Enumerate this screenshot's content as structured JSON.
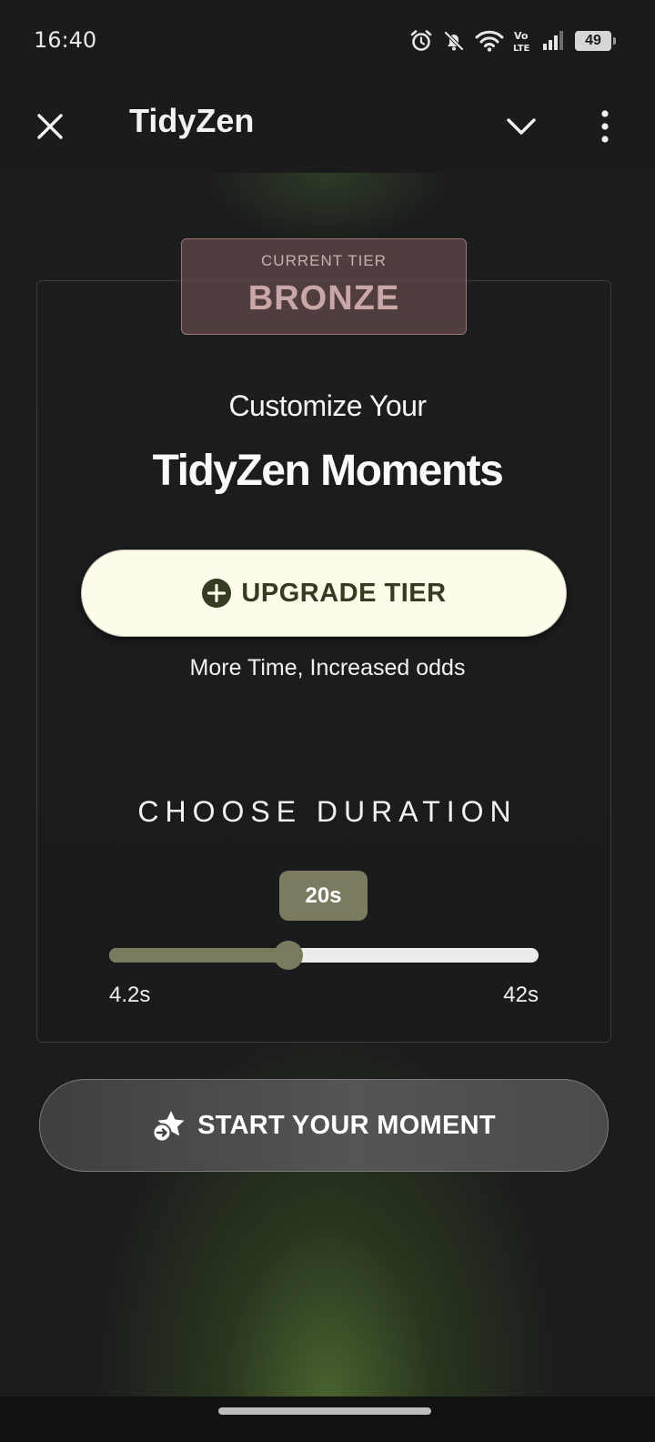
{
  "status_bar": {
    "time": "16:40",
    "battery": "49",
    "icons": [
      "alarm-icon",
      "bell-off-icon",
      "wifi-icon",
      "volte-icon",
      "signal-icon",
      "battery-icon"
    ]
  },
  "app_bar": {
    "title": "TidyZen",
    "icons": [
      "close-icon",
      "chevron-down-icon",
      "more-vert-icon"
    ]
  },
  "tier": {
    "label": "CURRENT TIER",
    "value": "BRONZE"
  },
  "heading": {
    "line1": "Customize Your",
    "line2": "TidyZen Moments"
  },
  "upgrade": {
    "label": "UPGRADE TIER",
    "icon": "plus-circle-icon",
    "subtitle": "More Time, Increased odds"
  },
  "duration": {
    "title": "CHOOSE DURATION",
    "value_label": "20s",
    "min_label": "4.2s",
    "max_label": "42s",
    "value": 20,
    "min": 4.2,
    "max": 42
  },
  "start": {
    "label": "START YOUR MOMENT",
    "icon": "star-arrow-icon"
  },
  "colors": {
    "accent": "#7a7a5e",
    "upgrade_bg": "#fdfbea",
    "tier_bg": "#5f4848",
    "background": "#1b1c1c"
  }
}
